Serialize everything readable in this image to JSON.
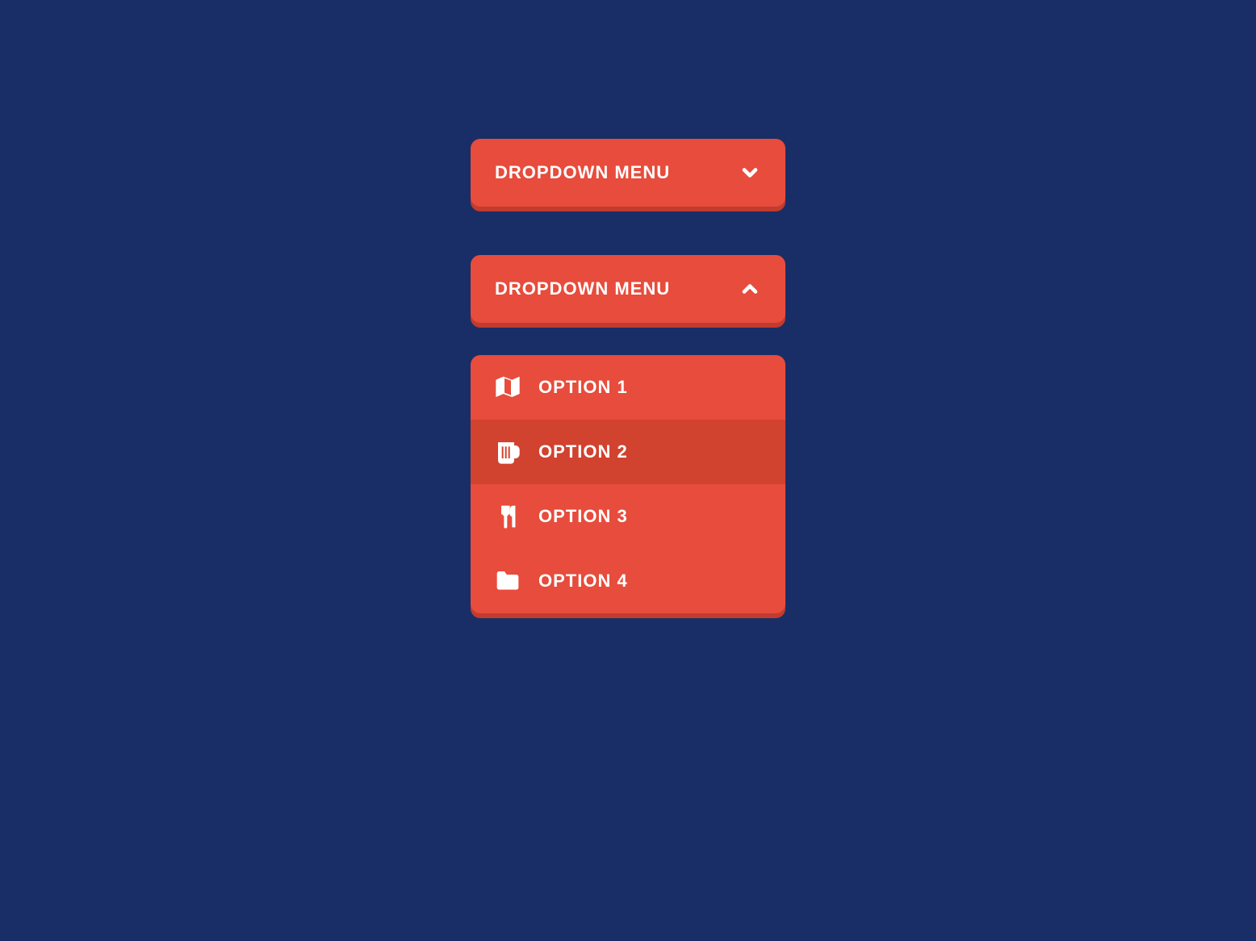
{
  "collapsed": {
    "label": "DROPDOWN MENU"
  },
  "expanded": {
    "label": "DROPDOWN MENU",
    "options": [
      {
        "label": "OPTION 1",
        "icon": "map"
      },
      {
        "label": "OPTION 2",
        "icon": "beer",
        "selected": true
      },
      {
        "label": "OPTION 3",
        "icon": "utensils"
      },
      {
        "label": "OPTION 4",
        "icon": "folder"
      }
    ]
  },
  "colors": {
    "background": "#192e66",
    "primary": "#e74c3c",
    "primaryDark": "#d1422f",
    "shadow": "#c23b2f",
    "text": "#ffffff"
  }
}
